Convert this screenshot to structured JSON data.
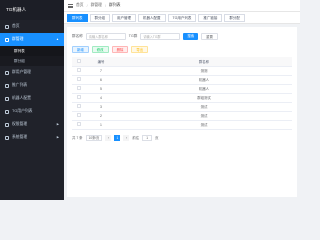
{
  "brand": {
    "title": "TG机器人"
  },
  "sidebar": {
    "items": [
      {
        "label": "首页"
      },
      {
        "label": "群管理"
      },
      {
        "label": "群列表"
      },
      {
        "label": "群分组"
      },
      {
        "label": "群用户管理"
      },
      {
        "label": "推广列表"
      },
      {
        "label": "机器人配置"
      },
      {
        "label": "TG用户列表"
      },
      {
        "label": "权限管理"
      },
      {
        "label": "系统管理"
      }
    ]
  },
  "header": {
    "crumbs": [
      "首页",
      "群管理",
      "群列表"
    ],
    "separator": "/"
  },
  "tabs": [
    {
      "label": "群列表"
    },
    {
      "label": "群分组"
    },
    {
      "label": "用户管理"
    },
    {
      "label": "机器人配置"
    },
    {
      "label": "TG用户列表"
    },
    {
      "label": "推广链接"
    },
    {
      "label": "群分配"
    }
  ],
  "filters": {
    "group_name_label": "群名称",
    "group_name_placeholder": "请输入群名称",
    "tg_group_label": "TG群",
    "tg_group_placeholder": "请输入TG群",
    "search_label": "搜索",
    "reset_label": "重置"
  },
  "actions": {
    "add": "新增",
    "edit": "修改",
    "delete": "删除",
    "export": "导出"
  },
  "table": {
    "columns": [
      "编号",
      "群名称"
    ],
    "rows": [
      {
        "no": "7",
        "name": "测测"
      },
      {
        "no": "6",
        "name": "机器人"
      },
      {
        "no": "5",
        "name": "机器人"
      },
      {
        "no": "4",
        "name": "群组测试"
      },
      {
        "no": "3",
        "name": "测试"
      },
      {
        "no": "2",
        "name": "测试"
      },
      {
        "no": "1",
        "name": "测试"
      }
    ]
  },
  "pagination": {
    "total_label": "共 7 条",
    "page_size": "10条/页",
    "prev": "‹",
    "current": "1",
    "next": "›",
    "goto_label": "前往",
    "goto_value": "1",
    "page_suffix": "页"
  },
  "colors": {
    "accent": "#1890ff",
    "sidebar_bg": "#20222a"
  }
}
